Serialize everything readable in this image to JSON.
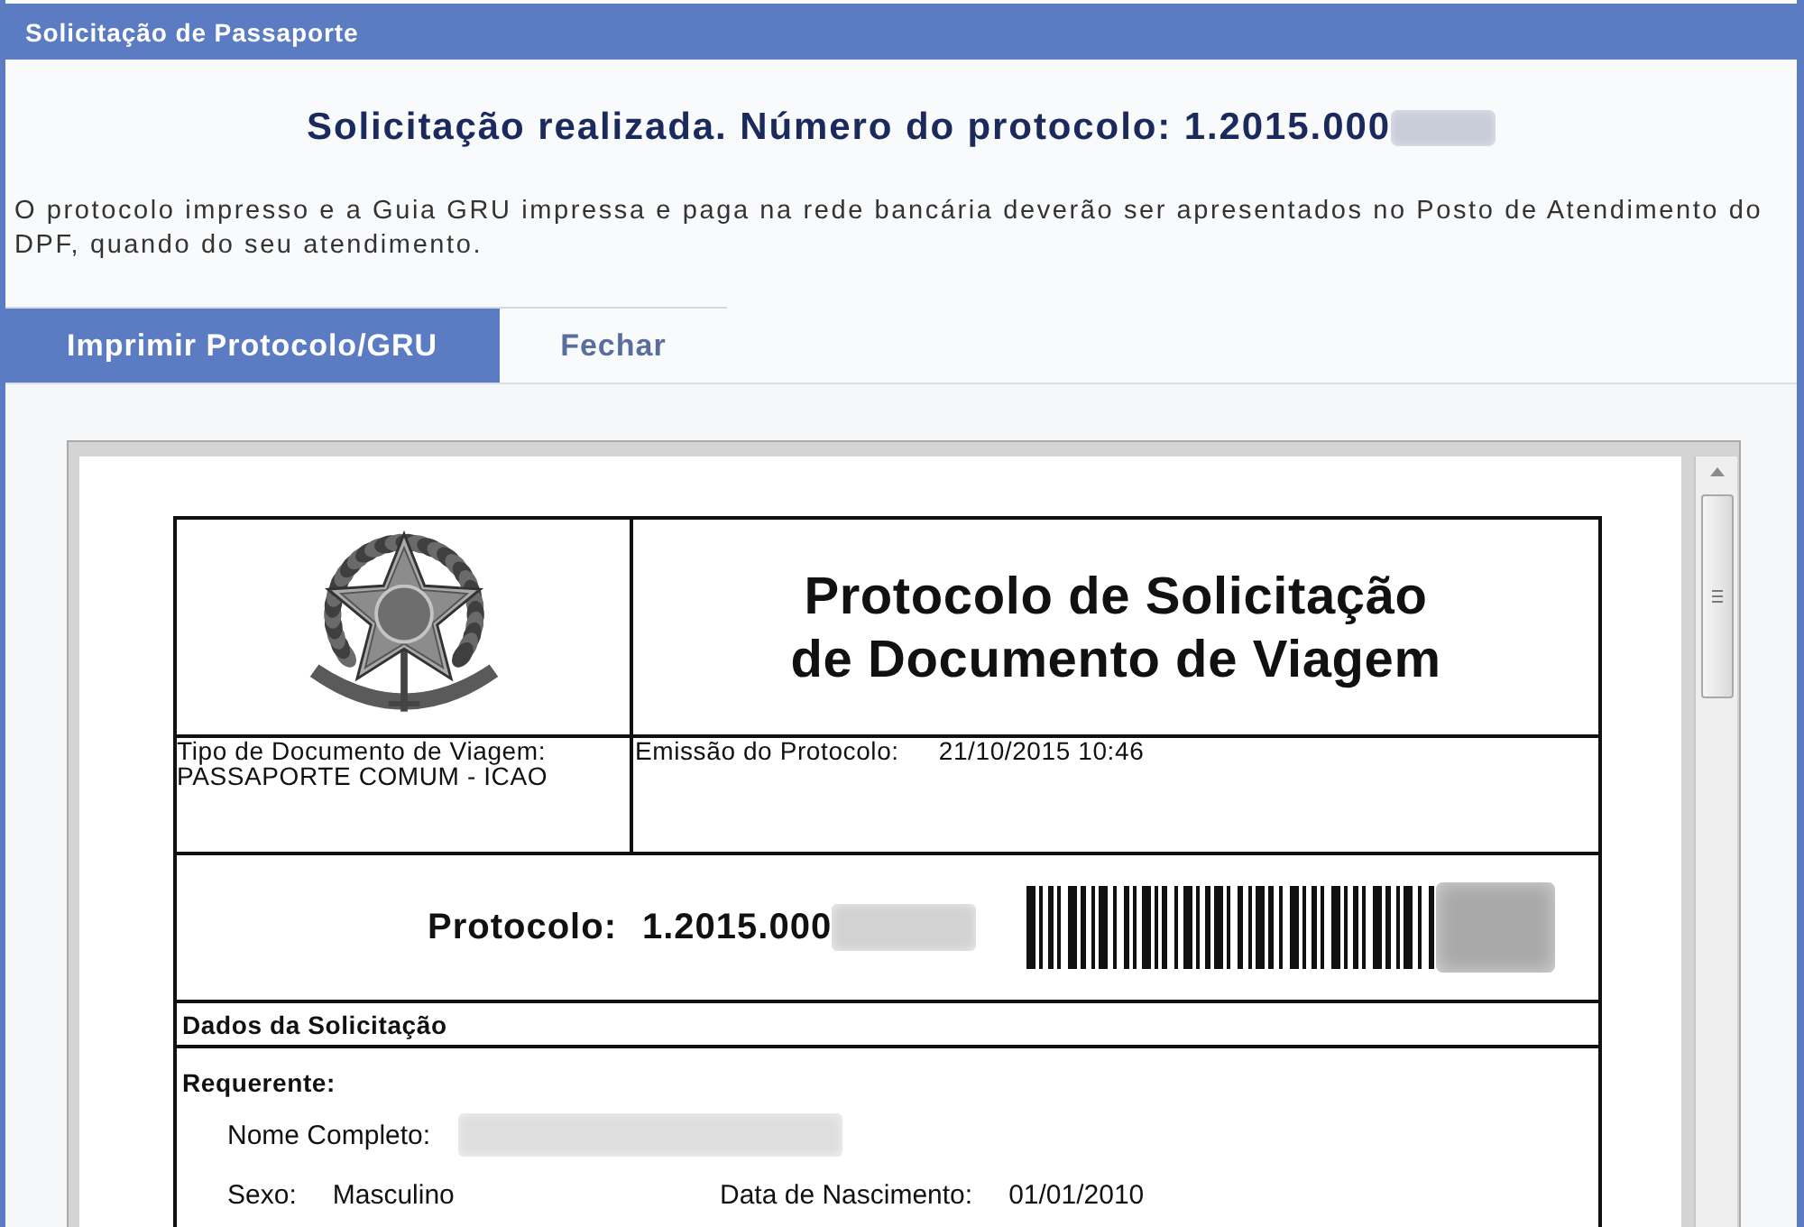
{
  "window": {
    "title": "Solicitação de Passaporte"
  },
  "confirmation": {
    "heading": "Solicitação realizada. Número do protocolo: 1.2015.000",
    "redacted": true,
    "notice": "O protocolo impresso e a Guia GRU impressa e paga na rede bancária deverão ser apresentados no Posto de Atendimento do DPF, quando do seu atendimento."
  },
  "tabs": [
    {
      "label": "Imprimir Protocolo/GRU",
      "selected": true
    },
    {
      "label": "Fechar",
      "selected": false
    }
  ],
  "document": {
    "title_lines": [
      "Protocolo de Solicitação",
      "de Documento de Viagem"
    ],
    "travel_document": {
      "label": "Tipo de Documento de Viagem:",
      "value": "PASSAPORTE COMUM - ICAO"
    },
    "issued": {
      "label": "Emissão do Protocolo:",
      "value": "21/10/2015 10:46"
    },
    "protocol": {
      "label": "Protocolo:",
      "value": "1.2015.000",
      "redacted": true
    },
    "section": "Dados da Solicitação",
    "applicant": {
      "heading": "Requerente:",
      "rows": [
        {
          "fields": [
            {
              "label": "Nome Completo:",
              "redacted": true
            }
          ]
        },
        {
          "fields": [
            {
              "label": "Sexo:",
              "value": "Masculino",
              "redacted": false
            },
            {
              "label": "Data de Nascimento:",
              "value": "01/01/2010",
              "redacted": false
            }
          ]
        }
      ]
    }
  }
}
